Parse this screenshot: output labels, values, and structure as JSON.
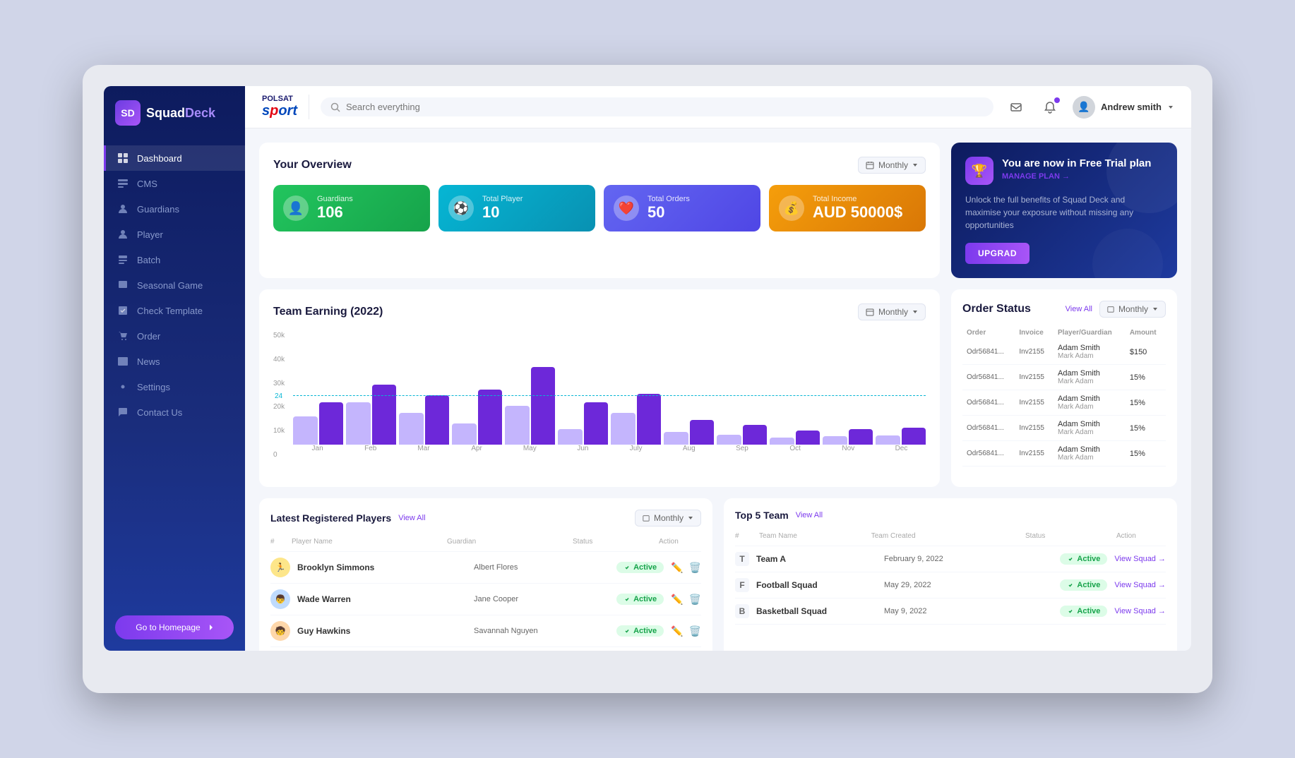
{
  "app": {
    "name": "SquadDeck",
    "name_bold": "Deck"
  },
  "brand": {
    "polsat": "POLSAT",
    "sport": "sport"
  },
  "header": {
    "search_placeholder": "Search everything",
    "user_name": "Andrew smith"
  },
  "sidebar": {
    "items": [
      {
        "id": "dashboard",
        "label": "Dashboard",
        "active": true
      },
      {
        "id": "cms",
        "label": "CMS",
        "active": false
      },
      {
        "id": "guardians",
        "label": "Guardians",
        "active": false
      },
      {
        "id": "player",
        "label": "Player",
        "active": false
      },
      {
        "id": "batch",
        "label": "Batch",
        "active": false
      },
      {
        "id": "seasonal-game",
        "label": "Seasonal Game",
        "active": false
      },
      {
        "id": "check-template",
        "label": "Check Template",
        "active": false
      },
      {
        "id": "order",
        "label": "Order",
        "active": false
      },
      {
        "id": "news",
        "label": "News",
        "active": false
      },
      {
        "id": "settings",
        "label": "Settings",
        "active": false
      },
      {
        "id": "contact-us",
        "label": "Contact Us",
        "active": false
      }
    ],
    "goto_btn": "Go to Homepage"
  },
  "overview": {
    "title": "Your Overview",
    "monthly_label": "Monthly",
    "stats": [
      {
        "id": "guardians",
        "label": "Guardians",
        "value": "106",
        "color": "green",
        "icon": "👤"
      },
      {
        "id": "total-player",
        "label": "Total Player",
        "value": "10",
        "color": "cyan",
        "icon": "⚽"
      },
      {
        "id": "total-orders",
        "label": "Total Orders",
        "value": "50",
        "color": "blue",
        "icon": "❤️"
      },
      {
        "id": "total-income",
        "label": "Total Income",
        "value": "AUD 50000$",
        "color": "orange",
        "icon": "💰"
      }
    ]
  },
  "trial": {
    "title": "You are now in Free Trial plan",
    "manage_label": "MANAGE PLAN →",
    "description": "Unlock the full benefits of Squad Deck and maximise your exposure without missing any opportunities",
    "upgrade_btn": "UPGRAD"
  },
  "chart": {
    "title": "Team Earning (2022)",
    "monthly_label": "Monthly",
    "y_labels": [
      "50k",
      "40k",
      "30k",
      "20k",
      "10k",
      "0"
    ],
    "dashed_value": "24",
    "months": [
      "Jan",
      "Feb",
      "Mar",
      "Apr",
      "May",
      "Jun",
      "July",
      "Aug",
      "Sep",
      "Oct",
      "Nov",
      "Dec"
    ],
    "bars": [
      {
        "light": 40,
        "dark": 55
      },
      {
        "light": 60,
        "dark": 80
      },
      {
        "light": 50,
        "dark": 65
      },
      {
        "light": 30,
        "dark": 75
      },
      {
        "light": 55,
        "dark": 100
      },
      {
        "light": 25,
        "dark": 60
      },
      {
        "light": 45,
        "dark": 70
      },
      {
        "light": 20,
        "dark": 40
      },
      {
        "light": 15,
        "dark": 30
      },
      {
        "light": 10,
        "dark": 20
      },
      {
        "light": 12,
        "dark": 22
      },
      {
        "light": 14,
        "dark": 25
      }
    ]
  },
  "order_status": {
    "title": "Order Status",
    "view_all": "View All",
    "monthly_label": "Monthly",
    "columns": [
      "Order",
      "Invoice",
      "Player/Guardian",
      "Amount"
    ],
    "rows": [
      {
        "order": "Odr56841...",
        "invoice": "Inv2155",
        "player": "Adam Smith",
        "guardian": "Mark Adam",
        "amount": "$150"
      },
      {
        "order": "Odr56841...",
        "invoice": "Inv2155",
        "player": "Adam Smith",
        "guardian": "Mark Adam",
        "amount": "15%"
      },
      {
        "order": "Odr56841...",
        "invoice": "Inv2155",
        "player": "Adam Smith",
        "guardian": "Mark Adam",
        "amount": "15%"
      },
      {
        "order": "Odr56841...",
        "invoice": "Inv2155",
        "player": "Adam Smith",
        "guardian": "Mark Adam",
        "amount": "15%"
      },
      {
        "order": "Odr56841...",
        "invoice": "Inv2155",
        "player": "Adam Smith",
        "guardian": "Mark Adam",
        "amount": "15%"
      }
    ]
  },
  "latest_players": {
    "title": "Latest Registered Players",
    "view_all": "View All",
    "monthly_label": "Monthly",
    "columns": [
      "#",
      "Player Name",
      "Guardian",
      "Status",
      "Action"
    ],
    "rows": [
      {
        "id": 1,
        "name": "Brooklyn Simmons",
        "guardian": "Albert Flores",
        "status": "Active"
      },
      {
        "id": 2,
        "name": "Wade Warren",
        "guardian": "Jane Cooper",
        "status": "Active"
      },
      {
        "id": 3,
        "name": "Guy Hawkins",
        "guardian": "Savannah Nguyen",
        "status": "Active"
      }
    ]
  },
  "top5_teams": {
    "title": "Top 5 Team",
    "view_all": "View All",
    "columns": [
      "#",
      "Team Name",
      "Team Created",
      "Status",
      "Action"
    ],
    "rows": [
      {
        "letter": "T",
        "name": "Team A",
        "created": "February 9, 2022",
        "status": "Active"
      },
      {
        "letter": "F",
        "name": "Football Squad",
        "created": "May 29, 2022",
        "status": "Active"
      },
      {
        "letter": "B",
        "name": "Basketball Squad",
        "created": "May 9, 2022",
        "status": "Active"
      }
    ],
    "action_label": "View Squad →"
  }
}
